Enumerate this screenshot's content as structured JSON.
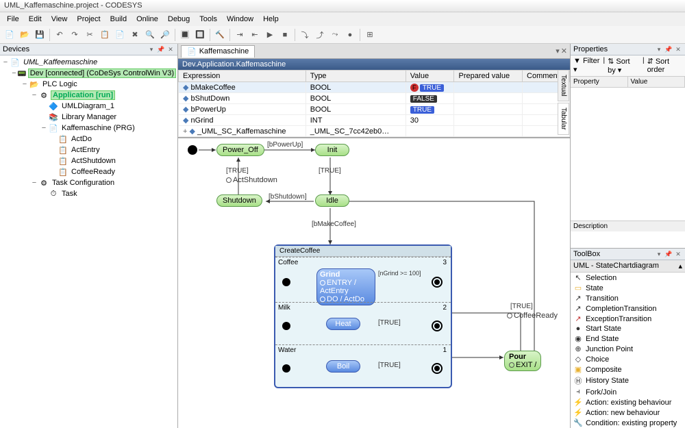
{
  "title": "UML_Kaffemaschine.project - CODESYS",
  "menu": [
    "File",
    "Edit",
    "View",
    "Project",
    "Build",
    "Online",
    "Debug",
    "Tools",
    "Window",
    "Help"
  ],
  "devices_title": "Devices",
  "tree": [
    {
      "d": 0,
      "exp": "−",
      "icon": "📄",
      "label": "UML_Kaffeemaschine",
      "italic": true
    },
    {
      "d": 1,
      "exp": "−",
      "icon": "📟",
      "label": "Dev [connected] (CoDeSys ControlWin V3)",
      "hl": "green"
    },
    {
      "d": 2,
      "exp": "−",
      "icon": "📂",
      "label": "PLC Logic"
    },
    {
      "d": 3,
      "exp": "−",
      "icon": "⚙",
      "label": "Application [run]",
      "hl": "green",
      "bold": true
    },
    {
      "d": 4,
      "exp": "",
      "icon": "🔷",
      "label": "UMLDiagram_1"
    },
    {
      "d": 4,
      "exp": "",
      "icon": "📚",
      "label": "Library Manager"
    },
    {
      "d": 4,
      "exp": "−",
      "icon": "📄",
      "label": "Kaffemaschine (PRG)"
    },
    {
      "d": 5,
      "exp": "",
      "icon": "📋",
      "label": "ActDo"
    },
    {
      "d": 5,
      "exp": "",
      "icon": "📋",
      "label": "ActEntry"
    },
    {
      "d": 5,
      "exp": "",
      "icon": "📋",
      "label": "ActShutdown"
    },
    {
      "d": 5,
      "exp": "",
      "icon": "📋",
      "label": "CoffeeReady"
    },
    {
      "d": 3,
      "exp": "−",
      "icon": "⚙",
      "label": "Task Configuration"
    },
    {
      "d": 4,
      "exp": "",
      "icon": "⏱",
      "label": "Task"
    }
  ],
  "doc_tab": "Kaffemaschine",
  "doc_path": "Dev.Application.Kaffemaschine",
  "var_cols": [
    "Expression",
    "Type",
    "Value",
    "Prepared value",
    "Comment"
  ],
  "vars": [
    {
      "exp": "bMakeCoffee",
      "type": "BOOL",
      "val": "TRUE",
      "f": true,
      "sel": true
    },
    {
      "exp": "bShutDown",
      "type": "BOOL",
      "val": "FALSE"
    },
    {
      "exp": "bPowerUp",
      "type": "BOOL",
      "val": "TRUE"
    },
    {
      "exp": "nGrind",
      "type": "INT",
      "val": "30",
      "plain": true
    },
    {
      "exp": "_UML_SC_Kaffemaschine",
      "type": "_UML_SC_7cc42eb0…",
      "val": "",
      "plain": true,
      "expandable": true
    }
  ],
  "side_tabs": [
    "Textual",
    "Tabular"
  ],
  "states": {
    "power_off": "Power_Off",
    "init": "Init",
    "shutdown": "Shutdown",
    "idle": "Idle",
    "create": "CreateCoffee",
    "coffee": "Coffee",
    "milk": "Milk",
    "water": "Water",
    "grind": "Grind",
    "heat": "Heat",
    "boil": "Boil",
    "pour": "Pour",
    "entry_act": "ENTRY / ActEntry",
    "do_act": "DO / ActDo",
    "exit_act": "EXIT /"
  },
  "guards": {
    "powerup": "[bPowerUp]",
    "true": "[TRUE]",
    "shutdown": "[bShutdown]",
    "makecoffee": "[bMakeCoffee]",
    "ngrind": "[nGrind >= 100]",
    "actshutdown": "ActShutdown",
    "coffeeready": "CoffeeReady"
  },
  "properties": {
    "title": "Properties",
    "filter": "Filter",
    "sortby": "Sort by",
    "sortorder": "Sort order",
    "col1": "Property",
    "col2": "Value",
    "desc": "Description"
  },
  "toolbox": {
    "title": "ToolBox",
    "header": "UML - StateChartdiagram",
    "items": [
      {
        "ic": "↖",
        "label": "Selection"
      },
      {
        "ic": "▭",
        "label": "State",
        "color": "#e8b030"
      },
      {
        "ic": "↗",
        "label": "Transition"
      },
      {
        "ic": "↗",
        "label": "CompletionTransition"
      },
      {
        "ic": "↗",
        "label": "ExceptionTransition",
        "color": "#c03030"
      },
      {
        "ic": "●",
        "label": "Start State"
      },
      {
        "ic": "◉",
        "label": "End State"
      },
      {
        "ic": "⊕",
        "label": "Junction Point"
      },
      {
        "ic": "◇",
        "label": "Choice"
      },
      {
        "ic": "▣",
        "label": "Composite",
        "color": "#e8b030"
      },
      {
        "ic": "Ⓗ",
        "label": "History State"
      },
      {
        "ic": "⫞",
        "label": "Fork/Join"
      },
      {
        "ic": "⚡",
        "label": "Action: existing behaviour"
      },
      {
        "ic": "⚡",
        "label": "Action: new behaviour",
        "color": "#c8a030"
      },
      {
        "ic": "🔧",
        "label": "Condition: existing property"
      }
    ]
  }
}
